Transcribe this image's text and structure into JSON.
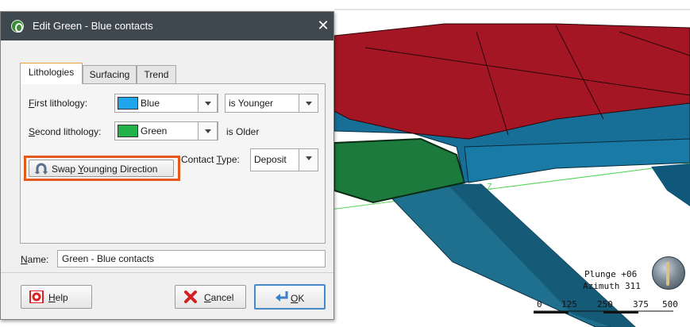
{
  "dialog": {
    "title": "Edit Green - Blue contacts",
    "close_glyph": "✕",
    "tabs": [
      {
        "label": "Lithologies",
        "active": true
      },
      {
        "label": "Surfacing",
        "active": false
      },
      {
        "label": "Trend",
        "active": false
      }
    ],
    "first_lithology": {
      "label_u": "F",
      "label_rest": "irst lithology:",
      "value": "Blue",
      "color": "#1ea5ea",
      "relation": "is Younger"
    },
    "second_lithology": {
      "label_u": "S",
      "label_rest": "econd lithology:",
      "value": "Green",
      "color": "#21b34a",
      "relation_text": "is Older"
    },
    "swap_button": {
      "pre": "Swap ",
      "u": "Y",
      "post": "ounging Direction",
      "icon": "swap-arrows-icon"
    },
    "contact_type": {
      "pre": "Contact ",
      "u": "T",
      "post": "ype:",
      "value": "Deposit"
    },
    "name": {
      "label_u": "N",
      "label_rest": "ame:",
      "value": "Green - Blue contacts"
    },
    "help": {
      "u": "H",
      "rest": "elp",
      "icon": "lifebuoy-icon"
    },
    "cancel": {
      "u": "C",
      "rest": "ancel",
      "icon": "red-x-icon"
    },
    "ok": {
      "u": "O",
      "rest": "K",
      "icon": "enter-arrow-icon"
    },
    "highlight_color": "#e4591e"
  },
  "scene": {
    "plunge": "Plunge +06",
    "azimuth": "Azimuth 311",
    "axis_letter": "Z",
    "scale_labels": [
      "0",
      "125",
      "250",
      "375",
      "500"
    ],
    "colors": {
      "red": "#a51625",
      "blue": "#136e99",
      "dark_blue": "#0f5879",
      "green": "#1b7a3c"
    }
  }
}
